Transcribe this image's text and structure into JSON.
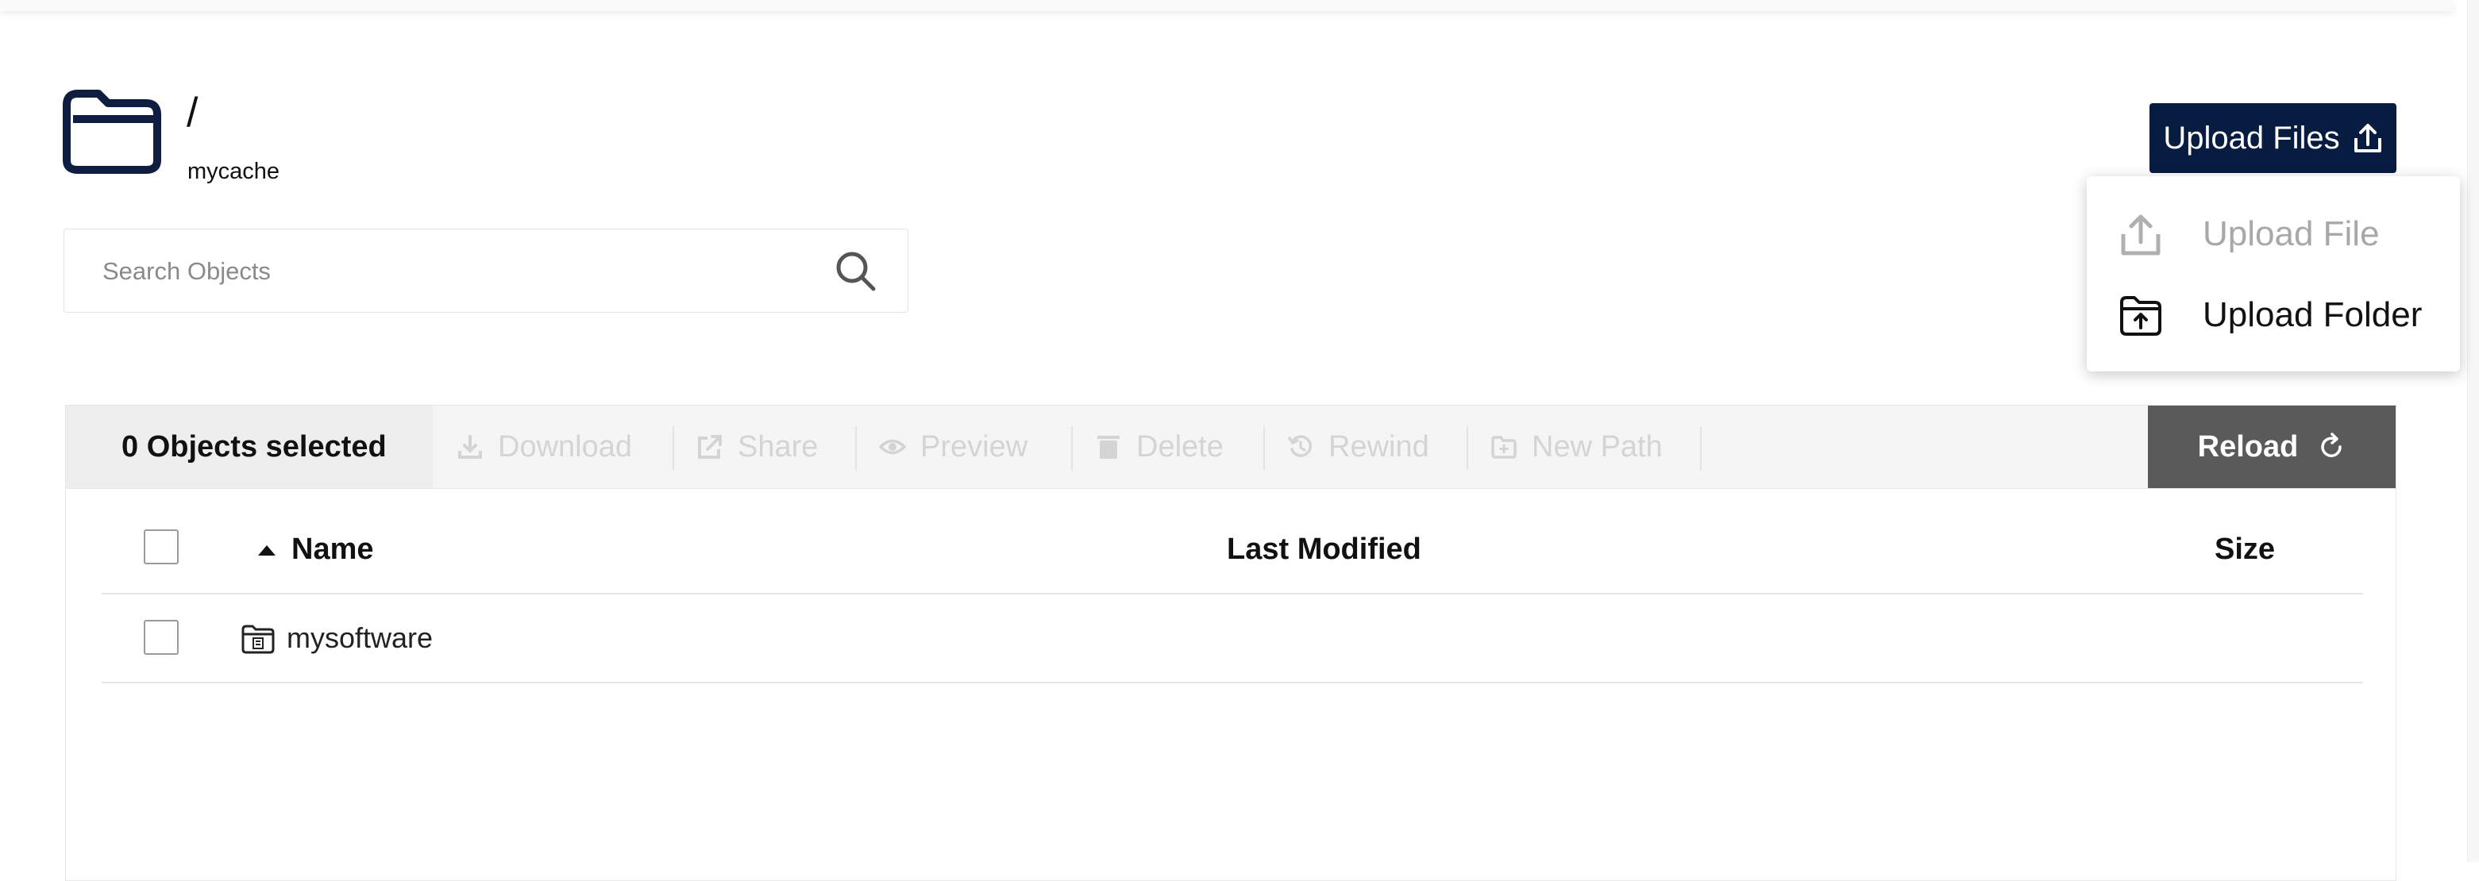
{
  "header": {
    "path": "/",
    "bucket": "mycache",
    "folder_icon": "folder-icon"
  },
  "upload": {
    "button_label": "Upload Files",
    "icon": "upload-icon",
    "menu": [
      {
        "label": "Upload File",
        "icon": "upload-icon",
        "enabled": false
      },
      {
        "label": "Upload Folder",
        "icon": "folder-upload-icon",
        "enabled": true
      }
    ]
  },
  "search": {
    "placeholder": "Search Objects",
    "value": "",
    "icon": "search-icon"
  },
  "toolbar": {
    "selected_label": "0 Objects selected",
    "actions": [
      {
        "label": "Download",
        "icon": "download-icon",
        "enabled": false
      },
      {
        "label": "Share",
        "icon": "share-icon",
        "enabled": false
      },
      {
        "label": "Preview",
        "icon": "eye-icon",
        "enabled": false
      },
      {
        "label": "Delete",
        "icon": "trash-icon",
        "enabled": false
      },
      {
        "label": "Rewind",
        "icon": "rewind-icon",
        "enabled": false
      },
      {
        "label": "New Path",
        "icon": "new-folder-icon",
        "enabled": false
      }
    ],
    "reload_label": "Reload",
    "reload_icon": "refresh-icon"
  },
  "table": {
    "columns": [
      {
        "label": "Name",
        "sorted": "ascending"
      },
      {
        "label": "Last Modified"
      },
      {
        "label": "Size"
      }
    ],
    "rows": [
      {
        "name": "mysoftware",
        "type": "folder",
        "last_modified": "",
        "size": ""
      }
    ]
  },
  "colors": {
    "primary": "#081c42",
    "reload": "#5a5a5a",
    "disabled_text": "#d4d4d4"
  }
}
